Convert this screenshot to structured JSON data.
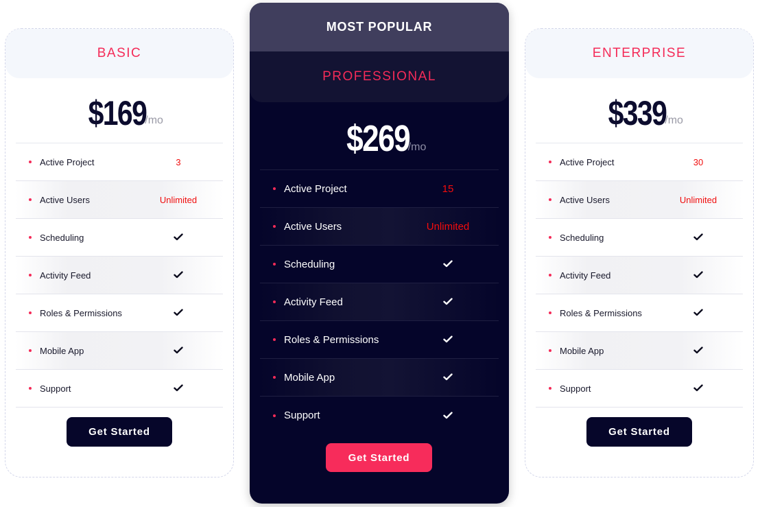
{
  "plans": [
    {
      "name": "BASIC",
      "price": "$169",
      "period": "/mo",
      "featured": false,
      "features": [
        {
          "label": "Active Project",
          "value": "3",
          "icon": null
        },
        {
          "label": "Active Users",
          "value": "Unlimited",
          "icon": null
        },
        {
          "label": "Scheduling",
          "value": null,
          "icon": "check-icon"
        },
        {
          "label": "Activity Feed",
          "value": null,
          "icon": "check-icon"
        },
        {
          "label": "Roles & Permissions",
          "value": null,
          "icon": "check-icon"
        },
        {
          "label": "Mobile App",
          "value": null,
          "icon": "check-icon"
        },
        {
          "label": "Support",
          "value": null,
          "icon": "check-icon"
        }
      ],
      "cta": "Get Started"
    },
    {
      "name": "PROFESSIONAL",
      "badge": "MOST POPULAR",
      "price": "$269",
      "period": "/mo",
      "featured": true,
      "features": [
        {
          "label": "Active Project",
          "value": "15",
          "icon": null
        },
        {
          "label": "Active Users",
          "value": "Unlimited",
          "icon": null
        },
        {
          "label": "Scheduling",
          "value": null,
          "icon": "check-icon"
        },
        {
          "label": "Activity Feed",
          "value": null,
          "icon": "check-icon"
        },
        {
          "label": "Roles & Permissions",
          "value": null,
          "icon": "check-icon"
        },
        {
          "label": "Mobile App",
          "value": null,
          "icon": "check-icon"
        },
        {
          "label": "Support",
          "value": null,
          "icon": "check-icon"
        }
      ],
      "cta": "Get Started"
    },
    {
      "name": "ENTERPRISE",
      "price": "$339",
      "period": "/mo",
      "featured": false,
      "features": [
        {
          "label": "Active Project",
          "value": "30",
          "icon": null
        },
        {
          "label": "Active Users",
          "value": "Unlimited",
          "icon": null
        },
        {
          "label": "Scheduling",
          "value": null,
          "icon": "check-icon"
        },
        {
          "label": "Activity Feed",
          "value": null,
          "icon": "check-icon"
        },
        {
          "label": "Roles & Permissions",
          "value": null,
          "icon": "check-icon"
        },
        {
          "label": "Mobile App",
          "value": null,
          "icon": "check-icon"
        },
        {
          "label": "Support",
          "value": null,
          "icon": "check-icon"
        }
      ],
      "cta": "Get Started"
    }
  ],
  "colors": {
    "accent": "#f42b58",
    "value_red": "#f00d0d",
    "navy": "#06062a",
    "popular_band": "#403e5d",
    "cta_featured": "#f72c5b"
  }
}
